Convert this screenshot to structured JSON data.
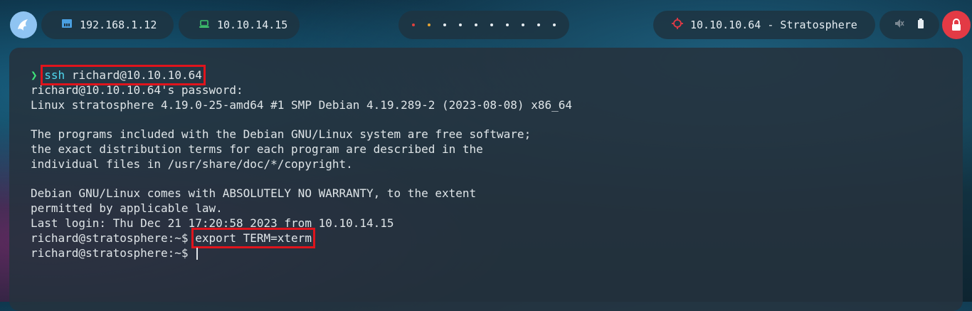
{
  "topbar": {
    "local_ip": "192.168.1.12",
    "vpn_ip": "10.10.14.15",
    "target": "10.10.10.64 - Stratosphere",
    "workspaces": [
      {
        "color": "#e0413c"
      },
      {
        "color": "#e6a434"
      },
      {
        "color": "#e8eef2"
      },
      {
        "color": "#e8eef2"
      },
      {
        "color": "#e8eef2"
      },
      {
        "color": "#e8eef2"
      },
      {
        "color": "#e8eef2"
      },
      {
        "color": "#e8eef2"
      },
      {
        "color": "#e8eef2"
      },
      {
        "color": "#e8eef2"
      }
    ],
    "icons": {
      "logo": "dragon-logo-icon",
      "local": "ethernet-icon",
      "vpn": "laptop-icon",
      "target": "crosshair-icon",
      "sound": "muted-speaker-icon",
      "battery": "battery-icon",
      "lock": "lock-icon"
    },
    "accent_colors": {
      "lock": "#e33a45",
      "vpn_icon": "#3ec46d",
      "local_icon": "#4a9fe0",
      "target_icon": "#e33a45"
    }
  },
  "terminal": {
    "prompt_arrow": "❯",
    "first_cmd_program": "ssh",
    "first_cmd_args": " richard@10.10.10.64",
    "output": [
      "richard@10.10.10.64's password:",
      "Linux stratosphere 4.19.0-25-amd64 #1 SMP Debian 4.19.289-2 (2023-08-08) x86_64",
      "",
      "The programs included with the Debian GNU/Linux system are free software;",
      "the exact distribution terms for each program are described in the",
      "individual files in /usr/share/doc/*/copyright.",
      "",
      "Debian GNU/Linux comes with ABSOLUTELY NO WARRANTY, to the extent",
      "permitted by applicable law.",
      "Last login: Thu Dec 21 17:20:58 2023 from 10.10.14.15"
    ],
    "shell_prompt": "richard@stratosphere:~$ ",
    "second_cmd": "export TERM=xterm",
    "third_prompt": "richard@stratosphere:~$ "
  },
  "highlight_color": "#e0141c"
}
